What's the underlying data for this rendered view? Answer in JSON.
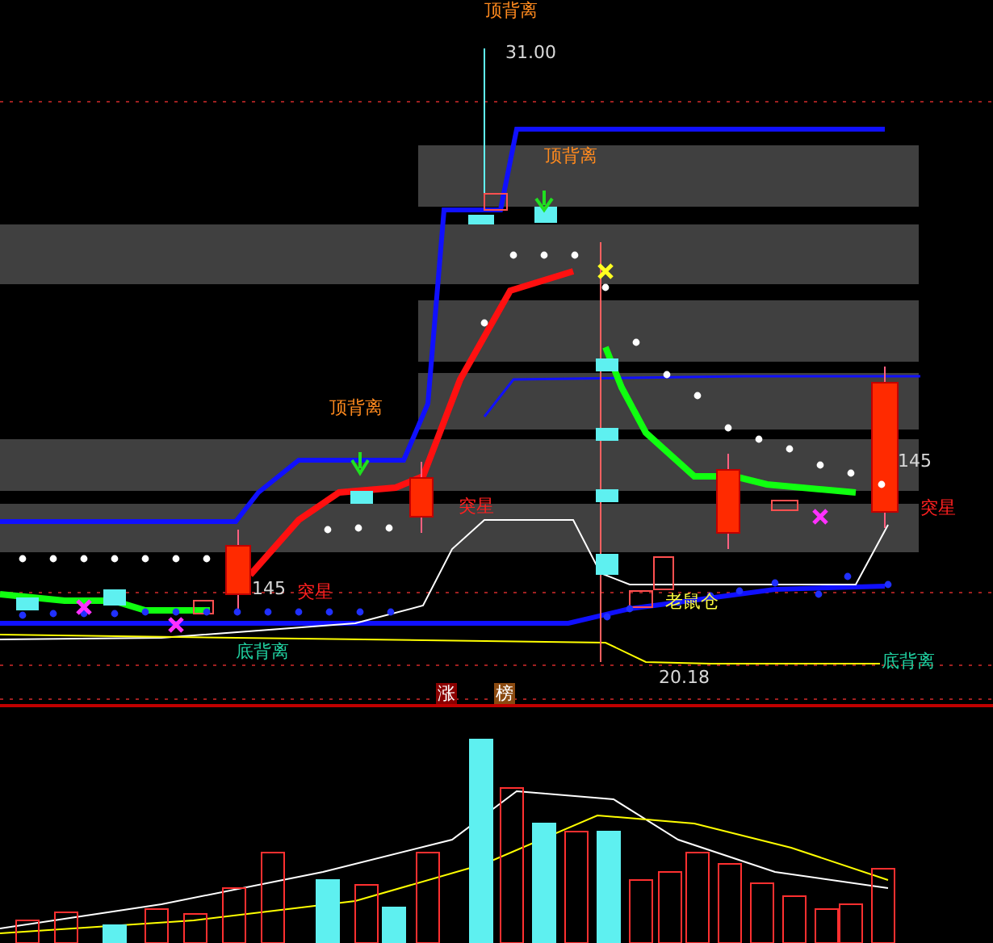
{
  "price_panel": {
    "labels": [
      {
        "text": "顶背离",
        "kind": "top-divergence"
      },
      {
        "text": "31.00",
        "kind": "price"
      },
      {
        "text": "顶背离",
        "kind": "top-divergence"
      },
      {
        "text": "顶背离",
        "kind": "top-divergence"
      },
      {
        "text": "突星",
        "kind": "breakout"
      },
      {
        "text": "145",
        "kind": "price"
      },
      {
        "text": "突星",
        "kind": "breakout"
      },
      {
        "text": "145",
        "kind": "price"
      },
      {
        "text": "突星",
        "kind": "breakout"
      },
      {
        "text": "老鼠仓",
        "kind": "rat-position"
      },
      {
        "text": "底背离",
        "kind": "bottom-divergence"
      },
      {
        "text": "20.18",
        "kind": "price"
      },
      {
        "text": "底背离",
        "kind": "bottom-divergence"
      }
    ]
  },
  "volume_panel": {
    "title_chars": [
      {
        "text": "涨",
        "kind": "up"
      },
      {
        "text": "榜",
        "kind": "ranking"
      }
    ]
  }
}
